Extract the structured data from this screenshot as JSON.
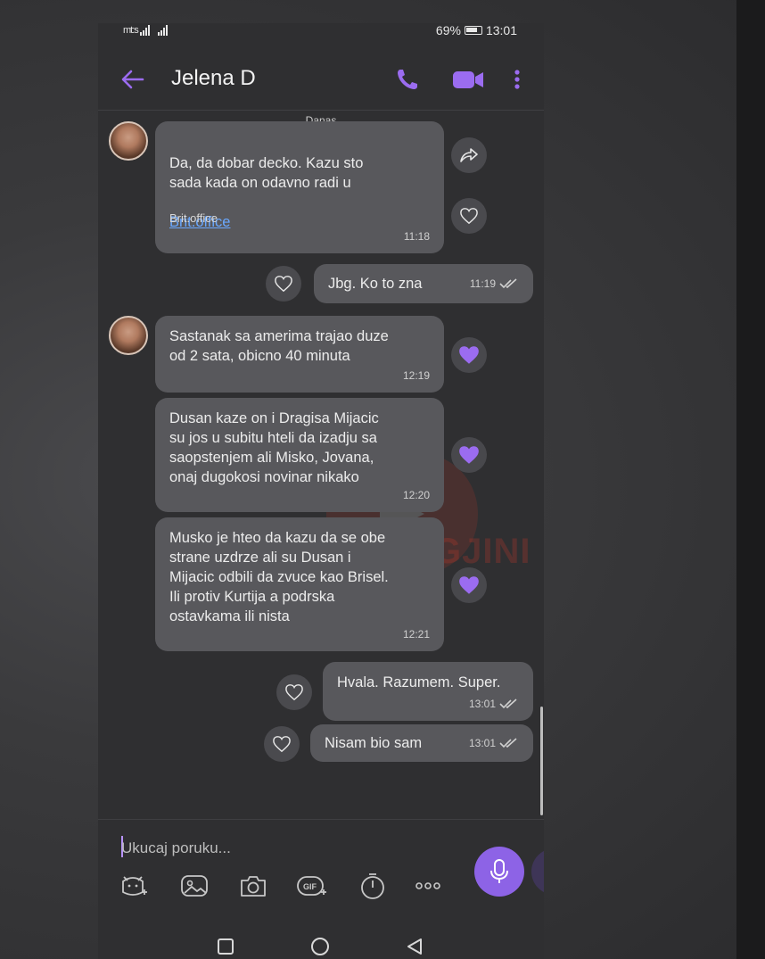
{
  "status": {
    "carrier": "mt:s",
    "battery": "69%",
    "time": "13:01"
  },
  "header": {
    "title": "Jelena D",
    "icons": [
      "back-arrow-icon",
      "phone-icon",
      "video-icon",
      "more-icon"
    ],
    "accent": "#9b6cf0"
  },
  "date_label": "Danas",
  "messages": [
    {
      "dir": "in",
      "text": "Da, da dobar decko. Kazu sto\nsada kada on odavno radi u",
      "link": "Brit.office",
      "preview": "Brit.office",
      "time": "11:18"
    },
    {
      "dir": "out",
      "text": "Jbg. Ko to zna",
      "time": "11:19"
    },
    {
      "dir": "in",
      "text": "Sastanak sa amerima trajao duze\nod  2 sata, obicno 40 minuta",
      "time": "12:19",
      "liked": true
    },
    {
      "dir": "in",
      "text": "Dusan kaze on i Dragisa Mijacic\nsu jos u subitu hteli da izadju sa\nsaopstenjem ali Misko, Jovana,\nonaj dugokosi novinar nikako",
      "time": "12:20",
      "liked": true
    },
    {
      "dir": "in",
      "text": "Musko je hteo da kazu da se obe\nstrane uzdrze ali su Dusan i\nMijacic odbili da zvuce kao Brisel.\nIli protiv Kurtija a podrska\nostavkama ili nista",
      "time": "12:21",
      "liked": true
    },
    {
      "dir": "out",
      "text": "Hvala. Razumem. Super.",
      "time": "13:01"
    },
    {
      "dir": "out",
      "text": "Nisam bio sam",
      "time": "13:01"
    }
  ],
  "watermark": "GJINI",
  "composer": {
    "placeholder": "Ukucaj poruku...",
    "tools": [
      "sticker-icon",
      "gallery-icon",
      "camera-icon",
      "gif-icon",
      "timer-icon",
      "more-dots-icon"
    ]
  }
}
